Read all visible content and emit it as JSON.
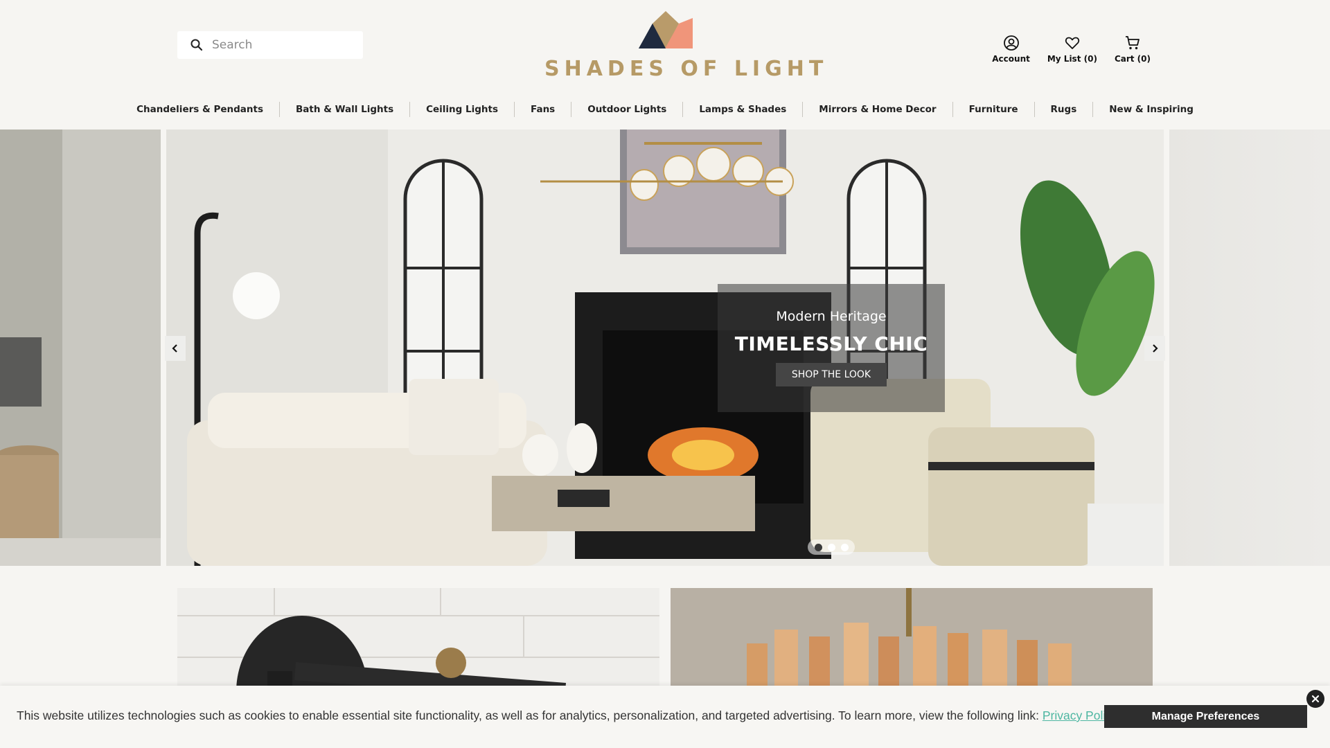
{
  "header": {
    "search": {
      "placeholder": "Search",
      "icon": "search-icon"
    },
    "brand": {
      "name": "SHADES OF LIGHT",
      "colors": {
        "text": "#b69a66",
        "mark_navy": "#1f2a3f",
        "mark_gold": "#b99b6a",
        "mark_coral": "#f0957a"
      }
    },
    "utilities": [
      {
        "icon": "account-icon",
        "label": "Account"
      },
      {
        "icon": "heart-icon",
        "label": "My List (0)"
      },
      {
        "icon": "cart-icon",
        "label": "Cart (0)"
      }
    ]
  },
  "nav": {
    "items": [
      "Chandeliers & Pendants",
      "Bath & Wall Lights",
      "Ceiling Lights",
      "Fans",
      "Outdoor Lights",
      "Lamps & Shades",
      "Mirrors & Home Decor",
      "Furniture",
      "Rugs",
      "New & Inspiring"
    ]
  },
  "hero": {
    "subtitle": "Modern Heritage",
    "title": "TIMELESSLY CHIC",
    "cta": "SHOP THE LOOK",
    "slide_count": 3,
    "active_slide": 1
  },
  "cookie_banner": {
    "text": "This website utilizes technologies such as cookies to enable essential site functionality, as well as for analytics, personalization, and targeted advertising. To learn more, view the following link: ",
    "link_text": "Privacy Policy",
    "button": "Manage Preferences",
    "link_color": "#4db6a1"
  }
}
